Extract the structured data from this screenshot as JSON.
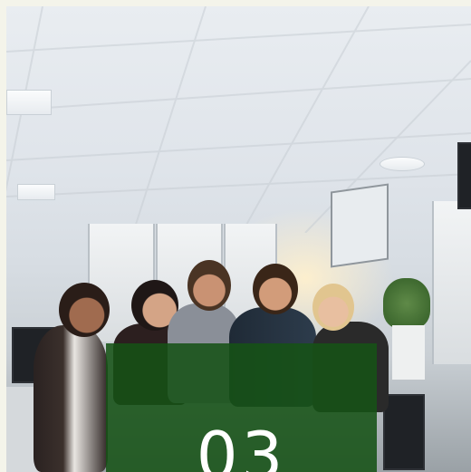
{
  "slide": {
    "number": "03"
  },
  "colors": {
    "overlay": "#165216",
    "frame_background": "#f4f4ea"
  }
}
